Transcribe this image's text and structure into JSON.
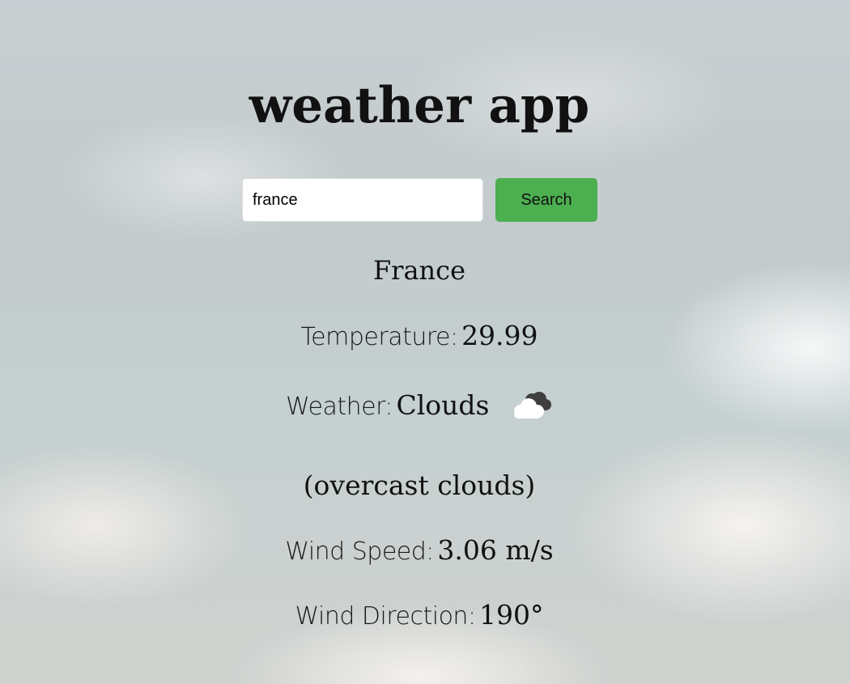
{
  "app": {
    "title": "weather app"
  },
  "search": {
    "value": "france",
    "button_label": "Search"
  },
  "result": {
    "city": "France",
    "temperature_label": "Temperature:",
    "temperature_value": "29.99",
    "weather_label": "Weather:",
    "weather_value": "Clouds",
    "weather_icon": "cloud-icon",
    "description": "(overcast clouds)",
    "wind_speed_label": "Wind Speed:",
    "wind_speed_value": "3.06 m/s",
    "wind_direction_label": "Wind Direction:",
    "wind_direction_value": "190°"
  },
  "colors": {
    "button": "#4caf50",
    "input_background": "#ffffff"
  }
}
